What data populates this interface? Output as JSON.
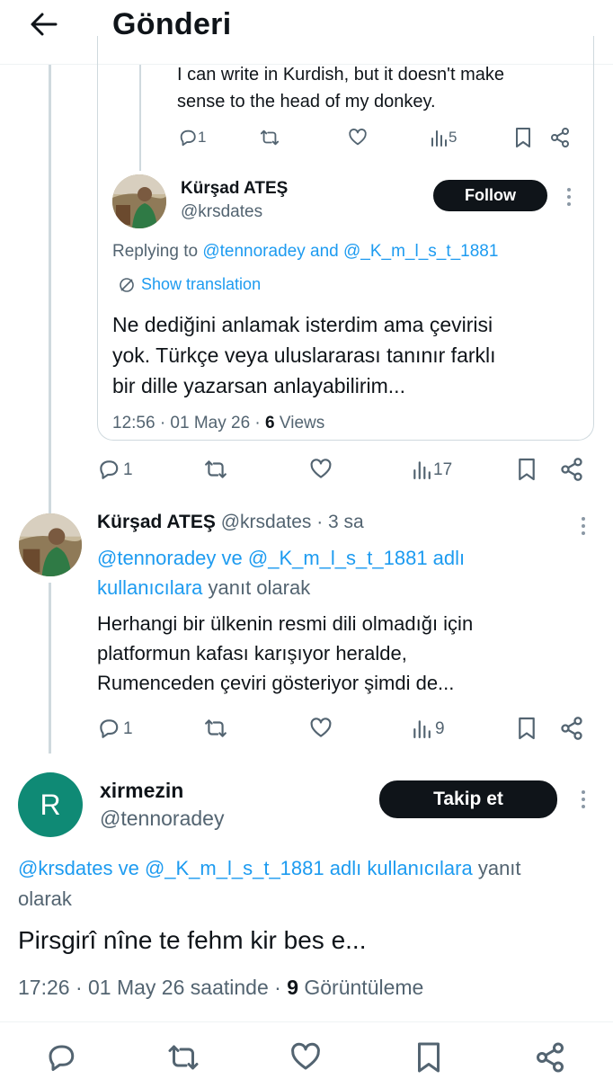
{
  "header": {
    "title": "Gönderi"
  },
  "quoted": {
    "text_line1": "I can write in Kurdish, but it doesn't make",
    "text_line2": "sense to the head of my donkey.",
    "actions": {
      "replies": "1",
      "views": "5"
    }
  },
  "inner_post": {
    "display_name": "Kürşad ATEŞ",
    "handle": "@krsdates",
    "follow_label": "Follow",
    "replying_prefix": "Replying to",
    "replying_user1": "@tennoradey",
    "replying_and": "and",
    "replying_user2": "@_K_m_l_s_t_1881",
    "show_translation": "Show translation",
    "text_line1": "Ne dediğini anlamak isterdim ama çevirisi",
    "text_line2": "yok. Türkçe veya uluslararası tanınır farklı",
    "text_line3": "bir dille yazarsan anlayabilirim...",
    "time": "12:56 · 01 May 26 · ",
    "views_count": "6",
    "views_label": " Views"
  },
  "outer_actions_1": {
    "replies": "1",
    "views": "17"
  },
  "reply_post": {
    "display_name": "Kürşad ATEŞ",
    "handle_time": "@krsdates · 3 sa",
    "replying_users_line1": "@tennoradey ve @_K_m_l_s_t_1881 adlı",
    "replying_users_line2": "kullanıcılara",
    "replying_suffix": " yanıt olarak",
    "text_line1": "Herhangi bir ülkenin resmi dili olmadığı için",
    "text_line2": "platformun kafası karışıyor heralde,",
    "text_line3": "Rumenceden çeviri gösteriyor şimdi de...",
    "actions": {
      "replies": "1",
      "views": "9"
    }
  },
  "main_post": {
    "avatar_letter": "R",
    "avatar_color": "#0f8a75",
    "display_name": "xirmezin",
    "handle": "@tennoradey",
    "follow_label": "Takip et",
    "replying_users": "@krsdates ve @_K_m_l_s_t_1881 adlı kullanıcılara",
    "replying_suffix": " yanıt",
    "replying_line2": "olarak",
    "text": "Pirsgirî nîne te fehm kir bes e...",
    "time": "17:26 · 01 May 26 saatinde · ",
    "views_count": "9",
    "views_label": " Görüntüleme"
  },
  "icons": [
    "back-arrow-icon",
    "reply-icon",
    "retweet-icon",
    "like-icon",
    "views-icon",
    "bookmark-icon",
    "share-icon",
    "more-icon",
    "translate-icon"
  ]
}
